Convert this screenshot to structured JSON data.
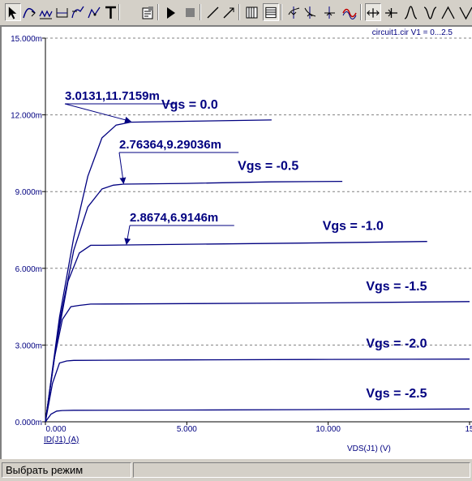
{
  "toolbar": {
    "buttons": [
      {
        "name": "select-mode-icon",
        "glyph": "select"
      },
      {
        "name": "curve-tool-icon",
        "glyph": "curve1"
      },
      {
        "name": "curve-tool2-icon",
        "glyph": "curve2"
      },
      {
        "name": "range-tool-icon",
        "glyph": "range"
      },
      {
        "name": "curve-tool3-icon",
        "glyph": "curve3"
      },
      {
        "name": "curve-tool4-icon",
        "glyph": "curve4"
      },
      {
        "name": "text-tool-icon",
        "glyph": "text"
      },
      {
        "name": "properties-icon",
        "glyph": "props"
      },
      {
        "name": "run-icon",
        "glyph": "run"
      },
      {
        "name": "stop-icon",
        "glyph": "stop"
      },
      {
        "name": "line-tool-icon",
        "glyph": "line"
      },
      {
        "name": "arrow-line-tool-icon",
        "glyph": "arrowline"
      },
      {
        "name": "grid-vertical-icon",
        "glyph": "gridv"
      },
      {
        "name": "grid-horizontal-icon",
        "glyph": "gridh"
      },
      {
        "name": "cursor-left-icon",
        "glyph": "cursor1"
      },
      {
        "name": "cursor-right-icon",
        "glyph": "cursor2"
      },
      {
        "name": "cursor-next-icon",
        "glyph": "cursor3"
      },
      {
        "name": "cursor-wave-icon",
        "glyph": "wave"
      },
      {
        "name": "cursor-crosshair-icon",
        "glyph": "cross1"
      },
      {
        "name": "cursor-crosshair2-icon",
        "glyph": "cross2"
      },
      {
        "name": "peak-icon",
        "glyph": "peak"
      },
      {
        "name": "valley-icon",
        "glyph": "valley"
      },
      {
        "name": "peak2-icon",
        "glyph": "peak2"
      },
      {
        "name": "valley2-icon",
        "glyph": "valley2"
      }
    ],
    "pressed": [
      "select-mode-icon",
      "grid-horizontal-icon",
      "cursor-crosshair-icon"
    ]
  },
  "chart_data": {
    "type": "line",
    "title": "circuit1.cir V1 = 0...2.5",
    "xlabel": "VDS(J1) (V)",
    "ylabel": "ID(J1) (A)",
    "xlim": [
      0,
      15
    ],
    "ylim": [
      0,
      0.015
    ],
    "x_ticks": [
      "0.000",
      "5.000",
      "10.000",
      "15"
    ],
    "y_ticks": [
      "0.000m",
      "3.000m",
      "6.000m",
      "9.000m",
      "12.000m",
      "15.000m"
    ],
    "grid": "horizontal dashed",
    "line_color": "#000080",
    "series": [
      {
        "name": "Vgs = 0.0",
        "x": [
          0,
          0.5,
          1.0,
          1.5,
          2.0,
          2.5,
          3.0131,
          5.0,
          8.0
        ],
        "y": [
          0,
          0.0041,
          0.0072,
          0.0096,
          0.0111,
          0.0116,
          0.0117159,
          0.01175,
          0.0118
        ]
      },
      {
        "name": "Vgs = -0.5",
        "x": [
          0,
          0.5,
          1.0,
          1.5,
          2.0,
          2.4,
          2.76364,
          5.0,
          8.0,
          10.5
        ],
        "y": [
          0,
          0.0039,
          0.0067,
          0.0084,
          0.0091,
          0.00925,
          0.00929036,
          0.00932,
          0.00938,
          0.0094
        ]
      },
      {
        "name": "Vgs = -1.0",
        "x": [
          0,
          0.4,
          0.8,
          1.2,
          1.6,
          2.0,
          2.8674,
          6.0,
          10.0,
          13.5
        ],
        "y": [
          0,
          0.0031,
          0.0055,
          0.0066,
          0.0069,
          0.0069,
          0.0069146,
          0.00695,
          0.007,
          0.00705
        ]
      },
      {
        "name": "Vgs = -1.5",
        "x": [
          0,
          0.3,
          0.6,
          0.9,
          1.2,
          1.6,
          5.0,
          10.0,
          15.0
        ],
        "y": [
          0,
          0.0024,
          0.004,
          0.0045,
          0.00455,
          0.0046,
          0.00462,
          0.00465,
          0.0047
        ]
      },
      {
        "name": "Vgs = -2.0",
        "x": [
          0,
          0.25,
          0.5,
          0.75,
          1.0,
          5.0,
          10.0,
          15.0
        ],
        "y": [
          0,
          0.0015,
          0.0023,
          0.00238,
          0.0024,
          0.00242,
          0.00244,
          0.00245
        ]
      },
      {
        "name": "Vgs = -2.5",
        "x": [
          0,
          0.2,
          0.4,
          0.6,
          1.0,
          5.0,
          10.0,
          15.0
        ],
        "y": [
          0,
          0.0003,
          0.00042,
          0.00044,
          0.00045,
          0.00046,
          0.00048,
          0.0005
        ]
      }
    ],
    "annotations": [
      {
        "text": "3.0131,11.7159m",
        "x": 3.0131,
        "y": 0.0117159
      },
      {
        "text": "2.76364,9.29036m",
        "x": 2.76364,
        "y": 0.00929036
      },
      {
        "text": "2.8674,6.9146m",
        "x": 2.8674,
        "y": 0.0069146
      }
    ]
  },
  "status": {
    "mode_text": "Выбрать режим",
    "second_text": ""
  }
}
